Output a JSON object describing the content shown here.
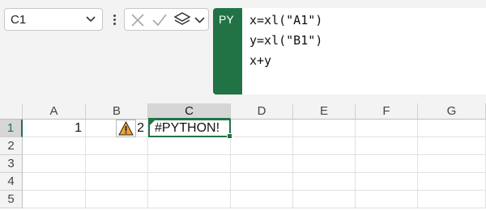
{
  "name_box": {
    "value": "C1",
    "caret": "chevron-down-icon"
  },
  "formula_tools": {
    "cancel": "cancel-x-icon",
    "enter": "check-icon",
    "data_type": "layers-icon"
  },
  "python_badge": {
    "label": "PY",
    "color": "#217346"
  },
  "formula": {
    "lines": [
      "x=xl(\"A1\")",
      "y=xl(\"B1\")",
      "x+y"
    ]
  },
  "columns": [
    "A",
    "B",
    "C",
    "D",
    "E",
    "F",
    "G"
  ],
  "active_column": "C",
  "rows": [
    "1",
    "2",
    "3",
    "4",
    "5"
  ],
  "active_row": "1",
  "cells": {
    "A1": "1",
    "B1": "2",
    "C1": "#PYTHON!"
  },
  "error_icon": "warning-triangle-icon",
  "colors": {
    "accent": "#217346",
    "warning": "#f0a030"
  }
}
